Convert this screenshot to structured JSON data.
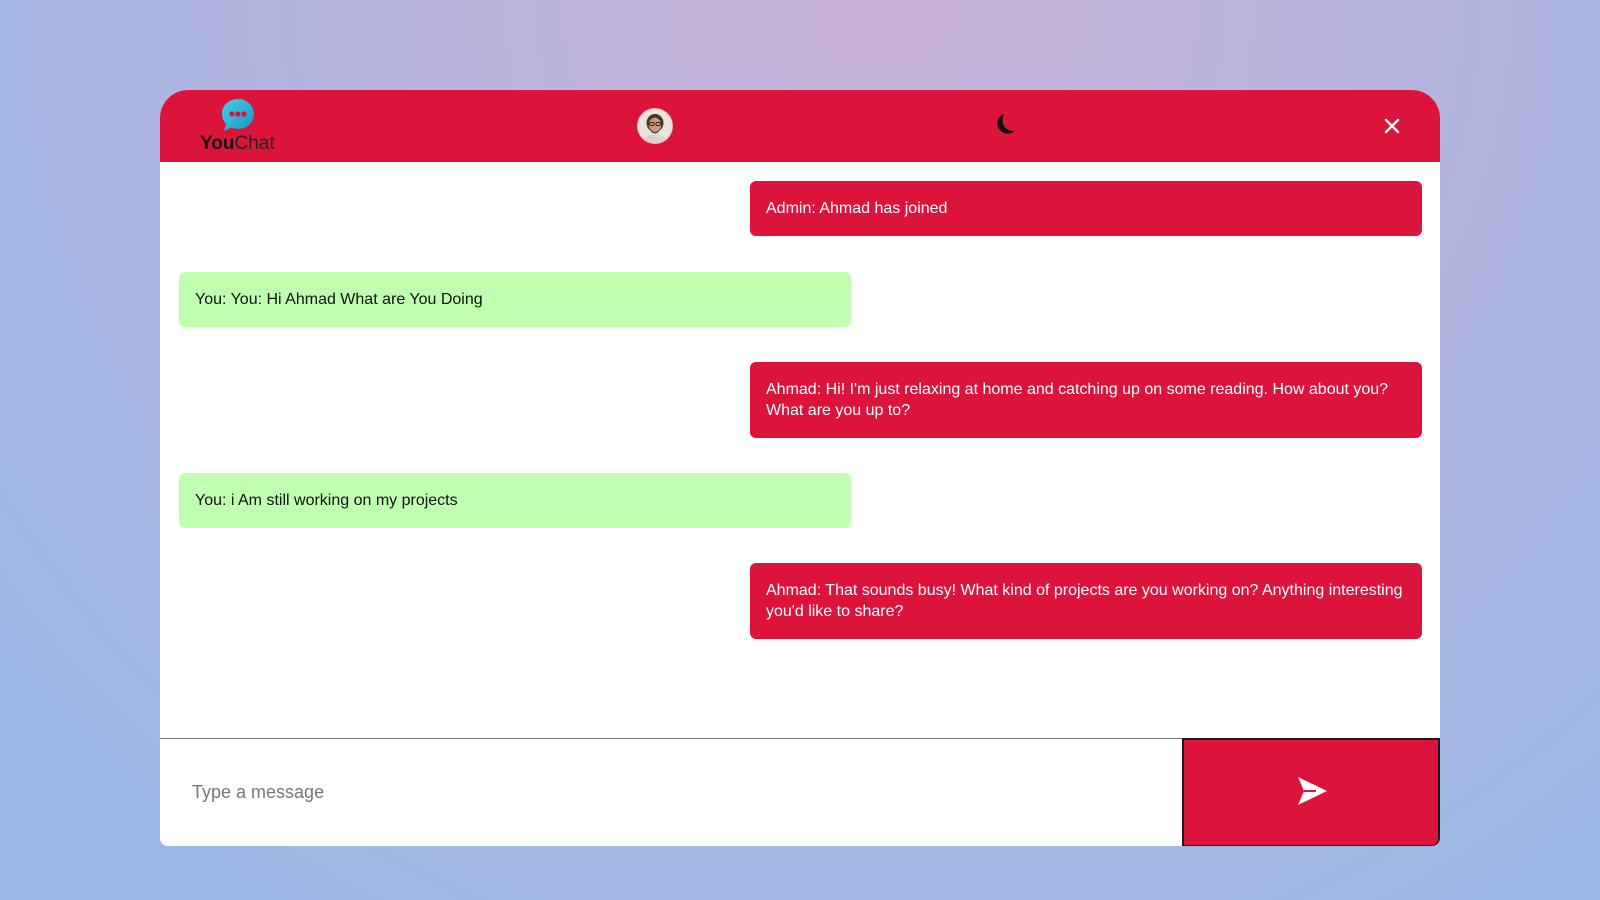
{
  "app": {
    "logo_you": "You",
    "logo_chat": "Chat"
  },
  "header": {
    "avatar_icon": "user-avatar",
    "theme_icon": "moon-icon",
    "close_icon": "close-icon"
  },
  "colors": {
    "accent": "#dc143c",
    "outgoing_bubble": "#c1ffb0",
    "logo_bubble": "#2bb7d6"
  },
  "messages": [
    {
      "direction": "in",
      "text": "Admin: Ahmad has joined"
    },
    {
      "direction": "out",
      "text": "You: You: Hi Ahmad What are You Doing"
    },
    {
      "direction": "in",
      "text": "Ahmad: Hi! I'm just relaxing at home and catching up on some reading. How about you? What are you up to?"
    },
    {
      "direction": "out",
      "text": "You: i Am still working on my projects"
    },
    {
      "direction": "in",
      "text": "Ahmad: That sounds busy! What kind of projects are you working on? Anything interesting you'd like to share?"
    }
  ],
  "composer": {
    "placeholder": "Type a message",
    "value": "",
    "send_icon": "send-icon"
  }
}
